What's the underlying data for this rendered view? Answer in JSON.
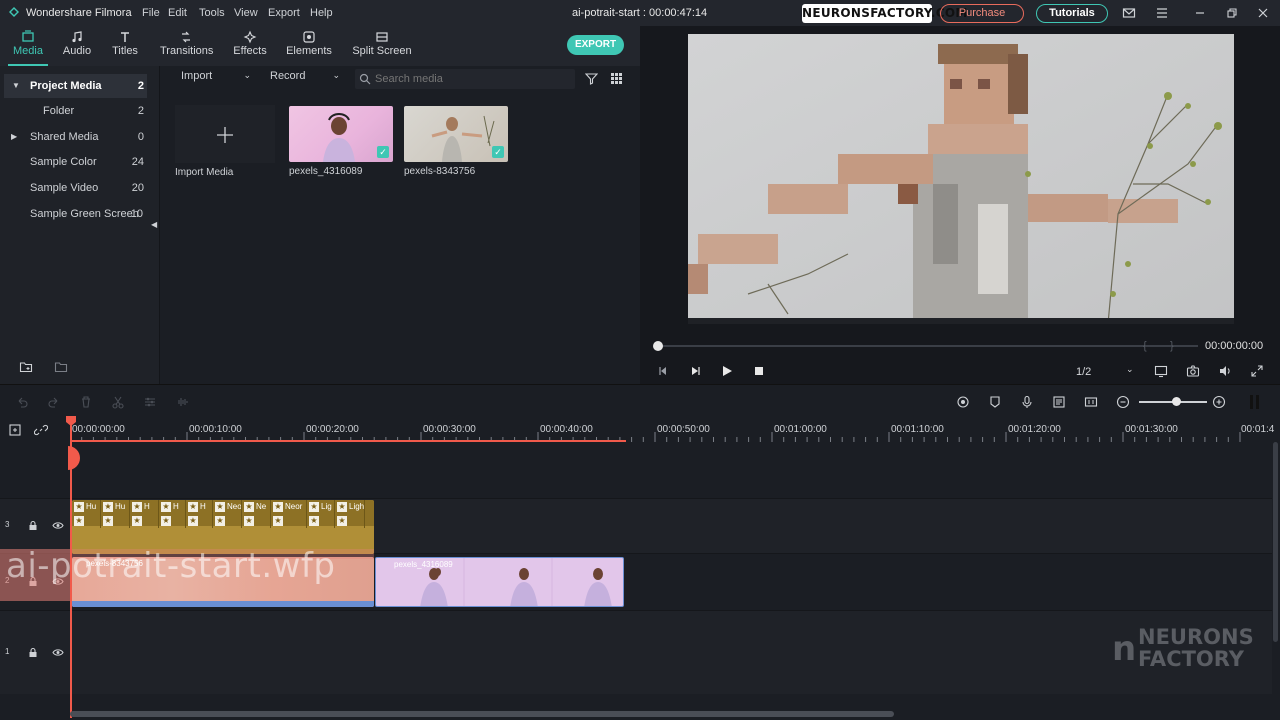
{
  "app": {
    "name": "Wondershare Filmora",
    "menu": [
      "File",
      "Edit",
      "Tools",
      "View",
      "Export",
      "Help"
    ],
    "document_title": "ai-potrait-start : 00:00:47:14",
    "badge": "NEURONSFACTORY.COM",
    "purchase_label": "Purchase",
    "tutorials_label": "Tutorials"
  },
  "tabs": [
    {
      "label": "Media",
      "icon": "media-icon",
      "active": true
    },
    {
      "label": "Audio",
      "icon": "music-icon",
      "active": false
    },
    {
      "label": "Titles",
      "icon": "titles-icon",
      "active": false
    },
    {
      "label": "Transitions",
      "icon": "transitions-icon",
      "active": false
    },
    {
      "label": "Effects",
      "icon": "effects-icon",
      "active": false
    },
    {
      "label": "Elements",
      "icon": "elements-icon",
      "active": false
    },
    {
      "label": "Split Screen",
      "icon": "split-screen-icon",
      "active": false
    }
  ],
  "export_label": "EXPORT",
  "sidebar": {
    "items": [
      {
        "label": "Project Media",
        "count": "2"
      },
      {
        "label": "Folder",
        "count": "2"
      },
      {
        "label": "Shared Media",
        "count": "0"
      },
      {
        "label": "Sample Color",
        "count": "24"
      },
      {
        "label": "Sample Video",
        "count": "20"
      },
      {
        "label": "Sample Green Screen",
        "count": "10"
      }
    ]
  },
  "media": {
    "import_label": "Import",
    "record_label": "Record",
    "search_placeholder": "Search media",
    "import_tile_label": "Import Media",
    "clips": [
      {
        "name": "pexels_4316089"
      },
      {
        "name": "pexels-8343756"
      }
    ]
  },
  "preview": {
    "time": "00:00:00:00",
    "quality": "1/2"
  },
  "timeline": {
    "ticks": [
      "00:00:00:00",
      "00:00:10:00",
      "00:00:20:00",
      "00:00:30:00",
      "00:00:40:00",
      "00:00:50:00",
      "00:01:00:00",
      "00:01:10:00",
      "00:01:20:00",
      "00:01:30:00",
      "00:01:4"
    ],
    "track_labels": [
      "3",
      "2",
      "1"
    ],
    "title_clips": [
      "Hu",
      "Hu",
      "H",
      "H",
      "H",
      "Neo",
      "Ne",
      "Neor",
      "Lig",
      "Light"
    ],
    "video_clip_a": "pexels-8343756",
    "video_clip_b": "pexels_4316089",
    "watermark_text": "ai-potrait-start.wfp"
  },
  "logo": {
    "line1": "NEURONS",
    "line2": "FACTORY"
  },
  "colors": {
    "accent": "#3fc7b4",
    "playhead": "#f15a4b",
    "purchase": "#e86b5c"
  }
}
